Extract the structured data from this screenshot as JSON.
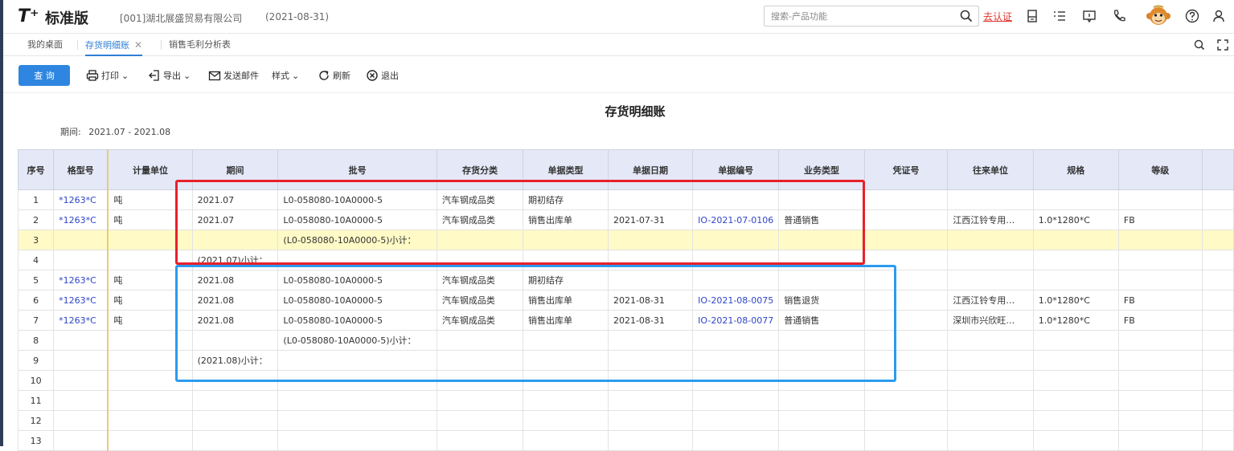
{
  "header": {
    "logo": "T⁺",
    "edition": "标准版",
    "company": "[001]湖北展盛贸易有限公司",
    "date": "(2021-08-31)",
    "search_placeholder": "搜索-产品功能",
    "auth_link": "去认证"
  },
  "tabs": [
    {
      "label": "我的桌面",
      "active": false
    },
    {
      "label": "存货明细账",
      "active": true
    },
    {
      "label": "销售毛利分析表",
      "active": false
    }
  ],
  "toolbar": {
    "query": "查 询",
    "print": "打印",
    "export": "导出",
    "email": "发送邮件",
    "style": "样式",
    "refresh": "刷新",
    "exit": "退出"
  },
  "report": {
    "title": "存货明细账",
    "period_label": "期间:",
    "period_value": "2021.07 - 2021.08"
  },
  "columns": [
    "序号",
    "格型号",
    "计量单位",
    "期间",
    "批号",
    "存货分类",
    "单据类型",
    "单据日期",
    "单据编号",
    "业务类型",
    "凭证号",
    "往来单位",
    "规格",
    "等级"
  ],
  "rows": [
    {
      "seq": "1",
      "model": "*1263*C",
      "unit": "吨",
      "period": "2021.07",
      "batch": "L0-058080-10A0000-5",
      "category": "汽车钢成品类",
      "doc_type": "期初结存",
      "doc_date": "",
      "doc_no": "",
      "biz_type": "",
      "voucher": "",
      "partner": "",
      "spec": "",
      "grade": ""
    },
    {
      "seq": "2",
      "model": "*1263*C",
      "unit": "吨",
      "period": "2021.07",
      "batch": "L0-058080-10A0000-5",
      "category": "汽车钢成品类",
      "doc_type": "销售出库单",
      "doc_date": "2021-07-31",
      "doc_no": "IO-2021-07-0106",
      "biz_type": "普通销售",
      "voucher": "",
      "partner": "江西江铃专用…",
      "spec": "1.0*1280*C",
      "grade": "FB"
    },
    {
      "seq": "3",
      "model": "",
      "unit": "",
      "period": "",
      "batch": "(L0-058080-10A0000-5)小计：",
      "category": "",
      "doc_type": "",
      "doc_date": "",
      "doc_no": "",
      "biz_type": "",
      "voucher": "",
      "partner": "",
      "spec": "",
      "grade": ""
    },
    {
      "seq": "4",
      "model": "",
      "unit": "",
      "period": "(2021.07)小计：",
      "batch": "",
      "category": "",
      "doc_type": "",
      "doc_date": "",
      "doc_no": "",
      "biz_type": "",
      "voucher": "",
      "partner": "",
      "spec": "",
      "grade": ""
    },
    {
      "seq": "5",
      "model": "*1263*C",
      "unit": "吨",
      "period": "2021.08",
      "batch": "L0-058080-10A0000-5",
      "category": "汽车钢成品类",
      "doc_type": "期初结存",
      "doc_date": "",
      "doc_no": "",
      "biz_type": "",
      "voucher": "",
      "partner": "",
      "spec": "",
      "grade": ""
    },
    {
      "seq": "6",
      "model": "*1263*C",
      "unit": "吨",
      "period": "2021.08",
      "batch": "L0-058080-10A0000-5",
      "category": "汽车钢成品类",
      "doc_type": "销售出库单",
      "doc_date": "2021-08-31",
      "doc_no": "IO-2021-08-0075",
      "biz_type": "销售退货",
      "voucher": "",
      "partner": "江西江铃专用…",
      "spec": "1.0*1280*C",
      "grade": "FB"
    },
    {
      "seq": "7",
      "model": "*1263*C",
      "unit": "吨",
      "period": "2021.08",
      "batch": "L0-058080-10A0000-5",
      "category": "汽车钢成品类",
      "doc_type": "销售出库单",
      "doc_date": "2021-08-31",
      "doc_no": "IO-2021-08-0077",
      "biz_type": "普通销售",
      "voucher": "",
      "partner": "深圳市兴欣旺…",
      "spec": "1.0*1280*C",
      "grade": "FB"
    },
    {
      "seq": "8",
      "model": "",
      "unit": "",
      "period": "",
      "batch": "(L0-058080-10A0000-5)小计：",
      "category": "",
      "doc_type": "",
      "doc_date": "",
      "doc_no": "",
      "biz_type": "",
      "voucher": "",
      "partner": "",
      "spec": "",
      "grade": ""
    },
    {
      "seq": "9",
      "model": "",
      "unit": "",
      "period": "(2021.08)小计：",
      "batch": "",
      "category": "",
      "doc_type": "",
      "doc_date": "",
      "doc_no": "",
      "biz_type": "",
      "voucher": "",
      "partner": "",
      "spec": "",
      "grade": ""
    },
    {
      "seq": "10",
      "model": "",
      "unit": "",
      "period": "",
      "batch": "",
      "category": "",
      "doc_type": "",
      "doc_date": "",
      "doc_no": "",
      "biz_type": "",
      "voucher": "",
      "partner": "",
      "spec": "",
      "grade": ""
    },
    {
      "seq": "11",
      "model": "",
      "unit": "",
      "period": "",
      "batch": "",
      "category": "",
      "doc_type": "",
      "doc_date": "",
      "doc_no": "",
      "biz_type": "",
      "voucher": "",
      "partner": "",
      "spec": "",
      "grade": ""
    },
    {
      "seq": "12",
      "model": "",
      "unit": "",
      "period": "",
      "batch": "",
      "category": "",
      "doc_type": "",
      "doc_date": "",
      "doc_no": "",
      "biz_type": "",
      "voucher": "",
      "partner": "",
      "spec": "",
      "grade": ""
    },
    {
      "seq": "13",
      "model": "",
      "unit": "",
      "period": "",
      "batch": "",
      "category": "",
      "doc_type": "",
      "doc_date": "",
      "doc_no": "",
      "biz_type": "",
      "voucher": "",
      "partner": "",
      "spec": "",
      "grade": ""
    }
  ],
  "highlight_row": "3",
  "colors": {
    "accent": "#2f86e0",
    "link": "#2f45c8",
    "auth": "#e0322b",
    "box_red": "#e8202a",
    "box_blue": "#2a9bf0",
    "row_highlight": "#fffac6"
  },
  "icons": [
    "search-icon",
    "doc-icon",
    "list-icon",
    "chat-icon",
    "phone-icon",
    "monkey-avatar",
    "help-icon",
    "user-icon",
    "printer-icon",
    "export-icon",
    "mail-icon",
    "refresh-icon",
    "close-circle-icon",
    "zoom-icon",
    "fullscreen-icon"
  ]
}
